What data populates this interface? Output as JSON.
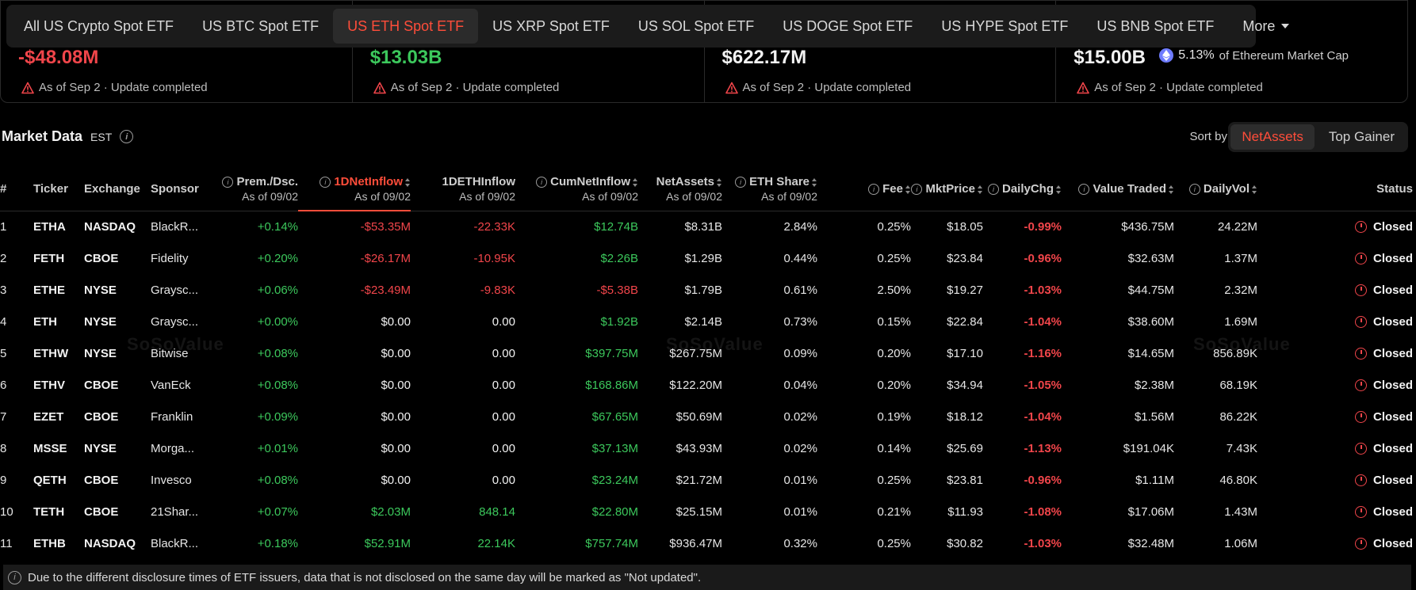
{
  "tabs": [
    {
      "label": "All US Crypto Spot ETF",
      "active": false
    },
    {
      "label": "US BTC Spot ETF",
      "active": false
    },
    {
      "label": "US ETH Spot ETF",
      "active": true
    },
    {
      "label": "US XRP Spot ETF",
      "active": false
    },
    {
      "label": "US SOL Spot ETF",
      "active": false
    },
    {
      "label": "US DOGE Spot ETF",
      "active": false
    },
    {
      "label": "US HYPE Spot ETF",
      "active": false
    },
    {
      "label": "US BNB Spot ETF",
      "active": false
    }
  ],
  "more_label": "More",
  "summary": [
    {
      "value": "-$48.08M",
      "note": "As of Sep 2 · Update completed"
    },
    {
      "value": "$13.03B",
      "note": "As of Sep 2 · Update completed"
    },
    {
      "value": "$622.17M",
      "note": "As of Sep 2 · Update completed"
    },
    {
      "value": "$15.00B",
      "pct": "5.13%",
      "pct_label": "of Ethereum Market Cap",
      "note": "As of Sep 2 · Update completed"
    }
  ],
  "market_data": {
    "title": "Market Data",
    "tz": "EST",
    "sort_by_label": "Sort by",
    "sort_options": [
      "NetAssets",
      "Top Gainer"
    ]
  },
  "columns": {
    "num": "#",
    "ticker": "Ticker",
    "exchange": "Exchange",
    "sponsor": "Sponsor",
    "prem": "Prem./Dsc.",
    "d1net": "1DNetInflow",
    "d1eth": "1DETHInflow",
    "cum": "CumNetInflow",
    "net": "NetAssets",
    "share": "ETH Share",
    "fee": "Fee",
    "mkt": "MktPrice",
    "chg": "DailyChg",
    "vt": "Value Traded",
    "vol": "DailyVol",
    "status": "Status",
    "asof": "As of 09/02"
  },
  "rows": [
    {
      "n": "1",
      "t": "ETHA",
      "ex": "NASDAQ",
      "sp": "BlackR...",
      "prem": "+0.14%",
      "d1": "-$53.35M",
      "eth": "-22.33K",
      "cum": "$12.74B",
      "net": "$8.31B",
      "share": "2.84%",
      "fee": "0.25%",
      "mkt": "$18.05",
      "chg": "-0.99%",
      "vt": "$436.75M",
      "vol": "24.22M",
      "st": "Closed",
      "d1c": "red",
      "ethc": "red",
      "cumc": "green"
    },
    {
      "n": "2",
      "t": "FETH",
      "ex": "CBOE",
      "sp": "Fidelity",
      "prem": "+0.20%",
      "d1": "-$26.17M",
      "eth": "-10.95K",
      "cum": "$2.26B",
      "net": "$1.29B",
      "share": "0.44%",
      "fee": "0.25%",
      "mkt": "$23.84",
      "chg": "-0.96%",
      "vt": "$32.63M",
      "vol": "1.37M",
      "st": "Closed",
      "d1c": "red",
      "ethc": "red",
      "cumc": "green"
    },
    {
      "n": "3",
      "t": "ETHE",
      "ex": "NYSE",
      "sp": "Graysc...",
      "prem": "+0.06%",
      "d1": "-$23.49M",
      "eth": "-9.83K",
      "cum": "-$5.38B",
      "net": "$1.79B",
      "share": "0.61%",
      "fee": "2.50%",
      "mkt": "$19.27",
      "chg": "-1.03%",
      "vt": "$44.75M",
      "vol": "2.32M",
      "st": "Closed",
      "d1c": "red",
      "ethc": "red",
      "cumc": "red"
    },
    {
      "n": "4",
      "t": "ETH",
      "ex": "NYSE",
      "sp": "Graysc...",
      "prem": "+0.00%",
      "d1": "$0.00",
      "eth": "0.00",
      "cum": "$1.92B",
      "net": "$2.14B",
      "share": "0.73%",
      "fee": "0.15%",
      "mkt": "$22.84",
      "chg": "-1.04%",
      "vt": "$38.60M",
      "vol": "1.69M",
      "st": "Closed",
      "d1c": "white",
      "ethc": "white",
      "cumc": "green"
    },
    {
      "n": "5",
      "t": "ETHW",
      "ex": "NYSE",
      "sp": "Bitwise",
      "prem": "+0.08%",
      "d1": "$0.00",
      "eth": "0.00",
      "cum": "$397.75M",
      "net": "$267.75M",
      "share": "0.09%",
      "fee": "0.20%",
      "mkt": "$17.10",
      "chg": "-1.16%",
      "vt": "$14.65M",
      "vol": "856.89K",
      "st": "Closed",
      "d1c": "white",
      "ethc": "white",
      "cumc": "green"
    },
    {
      "n": "6",
      "t": "ETHV",
      "ex": "CBOE",
      "sp": "VanEck",
      "prem": "+0.08%",
      "d1": "$0.00",
      "eth": "0.00",
      "cum": "$168.86M",
      "net": "$122.20M",
      "share": "0.04%",
      "fee": "0.20%",
      "mkt": "$34.94",
      "chg": "-1.05%",
      "vt": "$2.38M",
      "vol": "68.19K",
      "st": "Closed",
      "d1c": "white",
      "ethc": "white",
      "cumc": "green"
    },
    {
      "n": "7",
      "t": "EZET",
      "ex": "CBOE",
      "sp": "Franklin",
      "prem": "+0.09%",
      "d1": "$0.00",
      "eth": "0.00",
      "cum": "$67.65M",
      "net": "$50.69M",
      "share": "0.02%",
      "fee": "0.19%",
      "mkt": "$18.12",
      "chg": "-1.04%",
      "vt": "$1.56M",
      "vol": "86.22K",
      "st": "Closed",
      "d1c": "white",
      "ethc": "white",
      "cumc": "green"
    },
    {
      "n": "8",
      "t": "MSSE",
      "ex": "NYSE",
      "sp": "Morga...",
      "prem": "+0.01%",
      "d1": "$0.00",
      "eth": "0.00",
      "cum": "$37.13M",
      "net": "$43.93M",
      "share": "0.02%",
      "fee": "0.14%",
      "mkt": "$25.69",
      "chg": "-1.13%",
      "vt": "$191.04K",
      "vol": "7.43K",
      "st": "Closed",
      "d1c": "white",
      "ethc": "white",
      "cumc": "green"
    },
    {
      "n": "9",
      "t": "QETH",
      "ex": "CBOE",
      "sp": "Invesco",
      "prem": "+0.08%",
      "d1": "$0.00",
      "eth": "0.00",
      "cum": "$23.24M",
      "net": "$21.72M",
      "share": "0.01%",
      "fee": "0.25%",
      "mkt": "$23.81",
      "chg": "-0.96%",
      "vt": "$1.11M",
      "vol": "46.80K",
      "st": "Closed",
      "d1c": "white",
      "ethc": "white",
      "cumc": "green"
    },
    {
      "n": "10",
      "t": "TETH",
      "ex": "CBOE",
      "sp": "21Shar...",
      "prem": "+0.07%",
      "d1": "$2.03M",
      "eth": "848.14",
      "cum": "$22.80M",
      "net": "$25.15M",
      "share": "0.01%",
      "fee": "0.21%",
      "mkt": "$11.93",
      "chg": "-1.08%",
      "vt": "$17.06M",
      "vol": "1.43M",
      "st": "Closed",
      "d1c": "green",
      "ethc": "green",
      "cumc": "green"
    },
    {
      "n": "11",
      "t": "ETHB",
      "ex": "NASDAQ",
      "sp": "BlackR...",
      "prem": "+0.18%",
      "d1": "$52.91M",
      "eth": "22.14K",
      "cum": "$757.74M",
      "net": "$936.47M",
      "share": "0.32%",
      "fee": "0.25%",
      "mkt": "$30.82",
      "chg": "-1.03%",
      "vt": "$32.48M",
      "vol": "1.06M",
      "st": "Closed",
      "d1c": "green",
      "ethc": "green",
      "cumc": "green"
    }
  ],
  "watermark": "SoSoValue",
  "footnote": "Due to the different disclosure times of ETF issuers, data that is not disclosed on the same day will be marked as \"Not updated\".",
  "colors": {
    "accent": "#ff4d3a",
    "negative": "#f0454a",
    "positive": "#3cc85c"
  }
}
